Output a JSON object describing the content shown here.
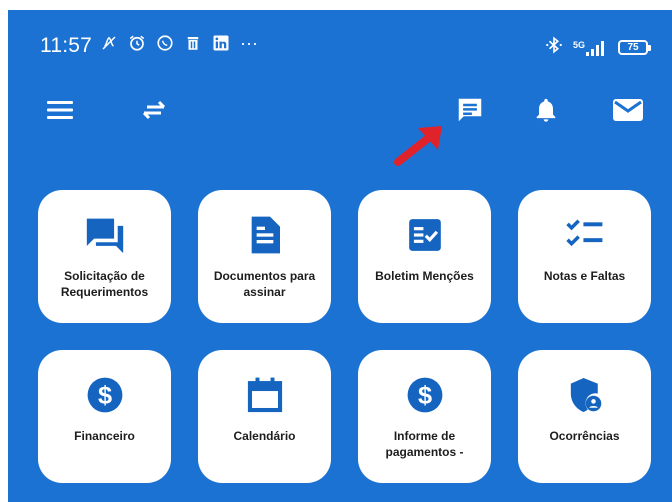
{
  "status_bar": {
    "time": "11:57",
    "left_icons": [
      "mute-icon",
      "alarm-icon",
      "whatsapp-icon",
      "delete-icon",
      "linkedin-icon",
      "more-dots-icon"
    ],
    "overflow": "···",
    "network": "5G",
    "battery": "75"
  },
  "app_bar": {
    "icons": [
      "menu-icon",
      "swap-icon",
      "chat-icon",
      "bell-icon",
      "mail-icon"
    ]
  },
  "cards": [
    {
      "id": "requerimentos",
      "icon": "forum-icon",
      "label": "Solicitação de\nRequerimentos"
    },
    {
      "id": "documentos",
      "icon": "document-icon",
      "label": "Documentos para\nassinar"
    },
    {
      "id": "boletim",
      "icon": "fact-check-icon",
      "label": "Boletim Menções"
    },
    {
      "id": "notas",
      "icon": "checklist-icon",
      "label": "Notas e Faltas"
    },
    {
      "id": "financeiro",
      "icon": "dollar-icon",
      "label": "Financeiro"
    },
    {
      "id": "calendario",
      "icon": "calendar-icon",
      "label": "Calendário"
    },
    {
      "id": "pagamentos",
      "icon": "dollar-icon",
      "label": "Informe de\npagamentos -"
    },
    {
      "id": "ocorrencias",
      "icon": "shield-user-icon",
      "label": "Ocorrências"
    }
  ],
  "colors": {
    "primary": "#1b72d3",
    "icon_blue": "#1565c0",
    "card_bg": "#ffffff",
    "annotation_arrow": "#e0232b"
  }
}
